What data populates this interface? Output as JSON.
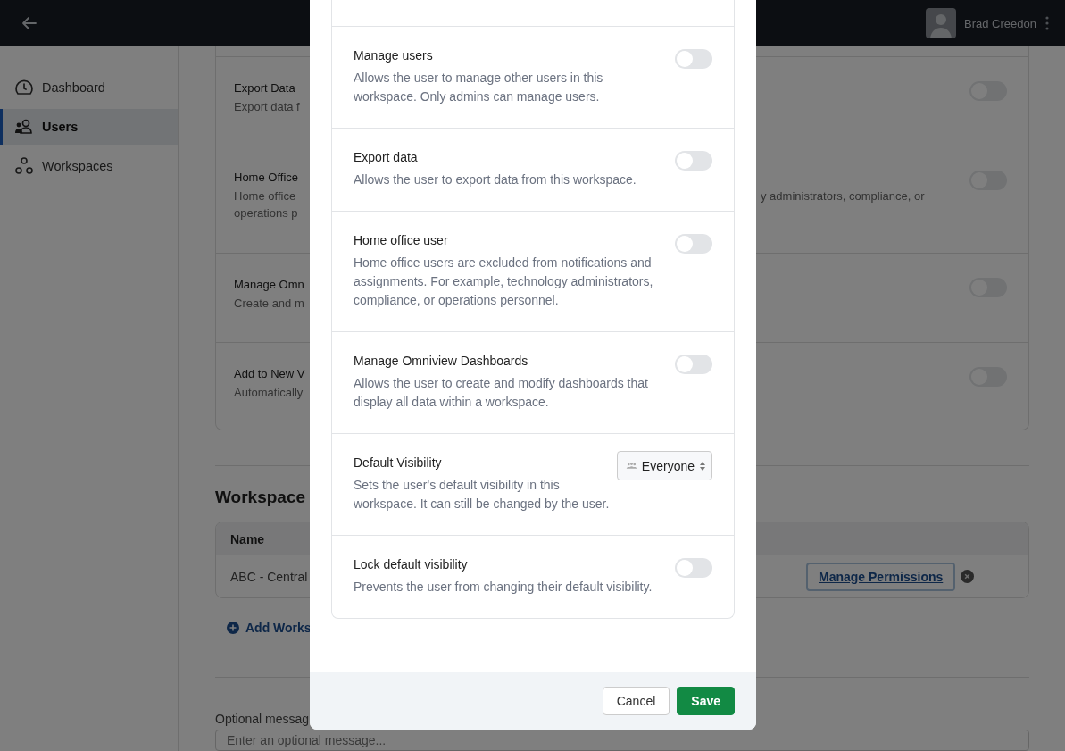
{
  "top_bar": {
    "user_name": "Brad Creedon"
  },
  "sidebar": {
    "items": [
      {
        "label": "Dashboard",
        "selected": false
      },
      {
        "label": "Users",
        "selected": true
      },
      {
        "label": "Workspaces",
        "selected": false
      }
    ]
  },
  "background_settings": [
    {
      "title": "Export Data",
      "description_lines": [
        "Export data f"
      ],
      "on": false
    },
    {
      "title": "Home Office",
      "description_lines": [
        "Home office",
        "operations p"
      ],
      "description_right": "y administrators, compliance, or",
      "on": false
    },
    {
      "title": "Manage Omn",
      "description_lines": [
        "Create and m"
      ],
      "on": false
    },
    {
      "title": "Add to New V",
      "description_lines": [
        "Automatically"
      ],
      "on": false
    }
  ],
  "workspaces": {
    "title": "Workspace",
    "columns": [
      "Name"
    ],
    "rows": [
      {
        "name": "ABC - Central",
        "action": "Manage Permissions"
      }
    ],
    "add_link": "Add Works"
  },
  "message": {
    "label": "Optional messag",
    "placeholder": "Enter an optional message..."
  },
  "modal": {
    "settings": [
      {
        "kind": "toggle",
        "title": "Manage users",
        "description": "Allows the user to manage other users in this workspace. Only admins can manage users.",
        "on": false
      },
      {
        "kind": "toggle",
        "title": "Export data",
        "description": "Allows the user to export data from this workspace.",
        "on": false
      },
      {
        "kind": "toggle",
        "title": "Home office user",
        "description": "Home office users are excluded from notifications and assignments. For example, technology administrators, compliance, or operations personnel.",
        "on": false
      },
      {
        "kind": "toggle",
        "title": "Manage Omniview Dashboards",
        "description": "Allows the user to create and modify dashboards that display all data within a workspace.",
        "on": false
      },
      {
        "kind": "select",
        "title": "Default Visibility",
        "description": "Sets the user's default visibility in this workspace. It can still be changed by the user.",
        "value": "Everyone"
      },
      {
        "kind": "toggle",
        "title": "Lock default visibility",
        "description": "Prevents the user from changing their default visibility.",
        "on": false
      }
    ],
    "buttons": [
      {
        "label": "Cancel",
        "kind": "secondary"
      },
      {
        "label": "Save",
        "kind": "primary"
      }
    ]
  }
}
